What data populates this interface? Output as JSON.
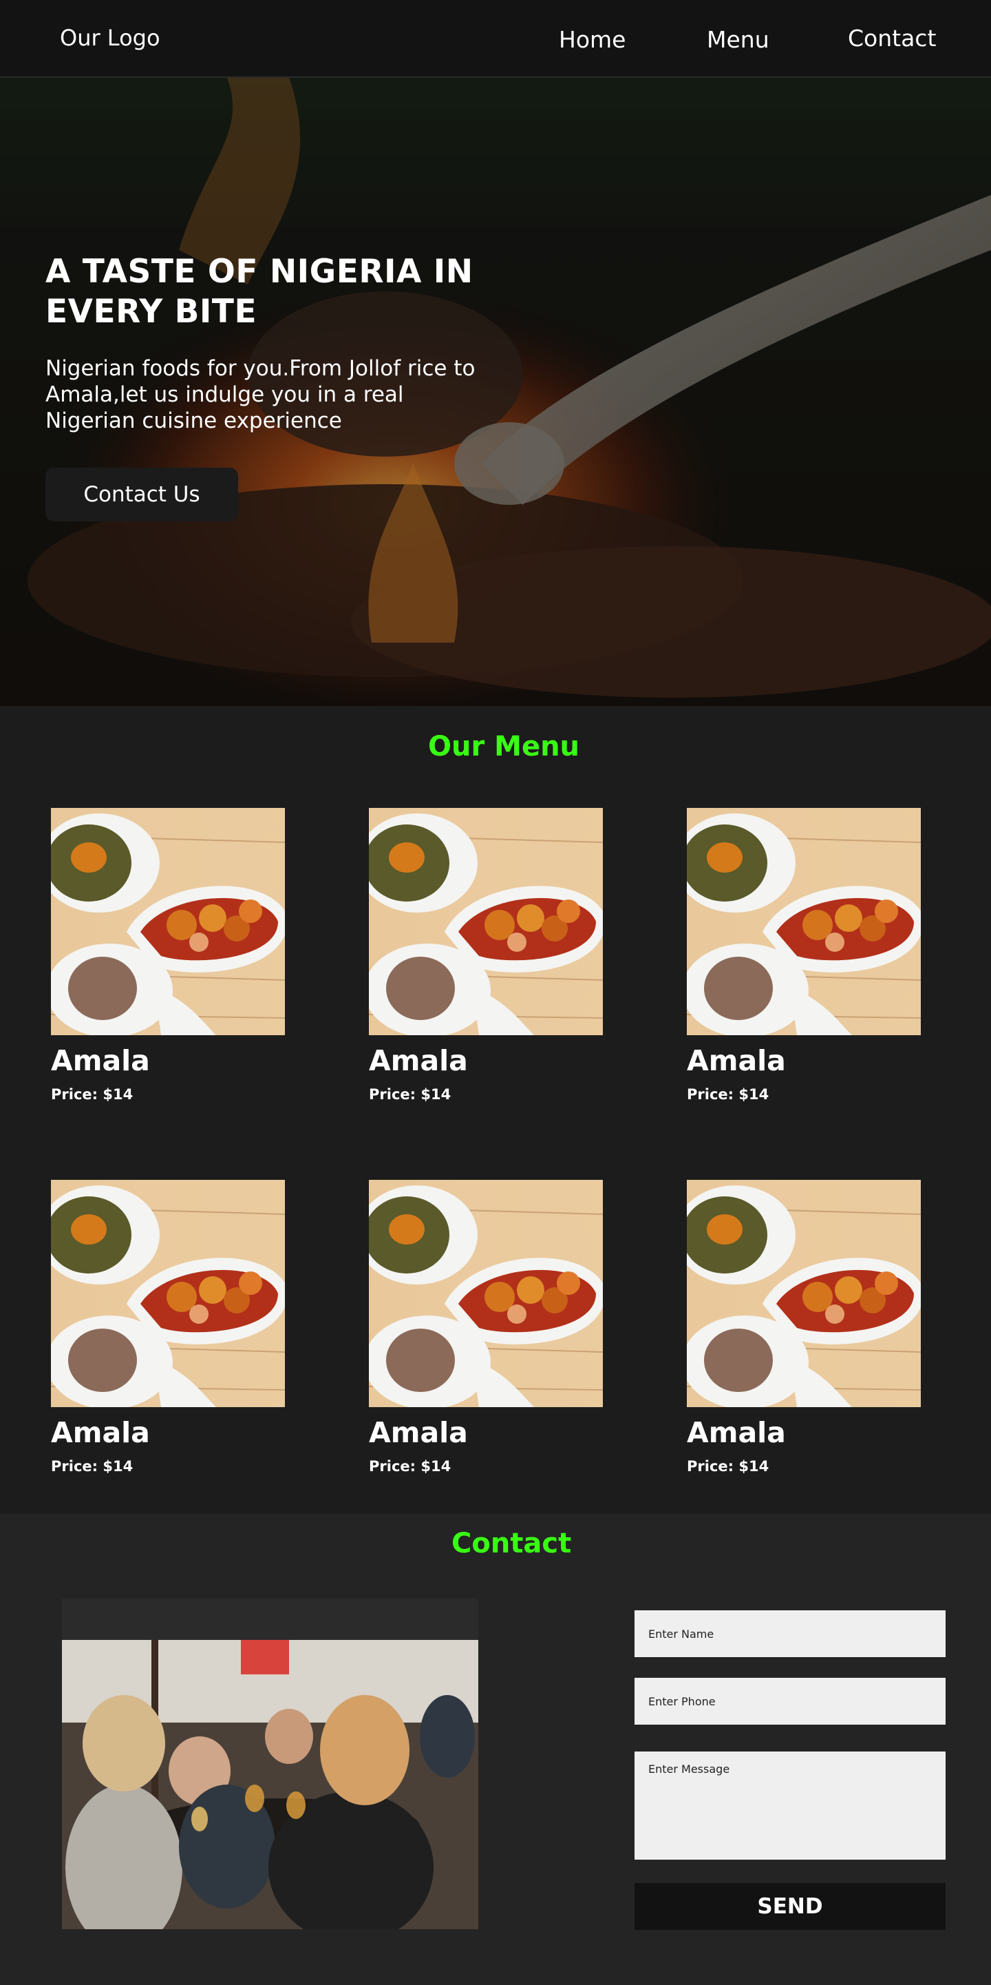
{
  "nav": {
    "logo": "Our Logo",
    "links": [
      "Home",
      "Menu",
      "Contact"
    ]
  },
  "hero": {
    "title": "A TASTE OF NIGERIA IN EVERY BITE",
    "subtitle": "Nigerian foods for you.From Jollof rice to Amala,let us indulge you in a real Nigerian cuisine experience",
    "cta": "Contact Us"
  },
  "menu": {
    "title": "Our Menu",
    "items": [
      {
        "name": "Amala",
        "price": "Price: $14"
      },
      {
        "name": "Amala",
        "price": "Price: $14"
      },
      {
        "name": "Amala",
        "price": "Price: $14"
      },
      {
        "name": "Amala",
        "price": "Price: $14"
      },
      {
        "name": "Amala",
        "price": "Price: $14"
      },
      {
        "name": "Amala",
        "price": "Price: $14"
      }
    ]
  },
  "contact": {
    "title": "Contact",
    "name_placeholder": "Enter Name",
    "phone_placeholder": "Enter Phone",
    "message_placeholder": "Enter Message",
    "send_label": "SEND"
  },
  "colors": {
    "accent": "#39ff14",
    "nav_bg": "#131313",
    "page_bg": "#1c1c1c",
    "contact_bg": "#242424"
  }
}
